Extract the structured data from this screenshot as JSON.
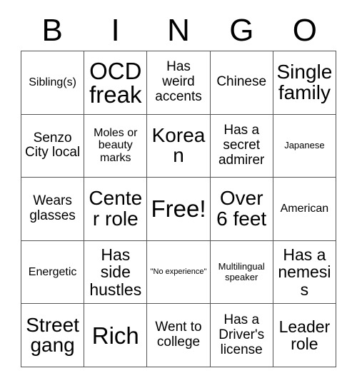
{
  "header": {
    "letters": [
      "B",
      "I",
      "N",
      "G",
      "O"
    ]
  },
  "colors": {
    "grid_line": "#555555",
    "text": "#000000",
    "background": "#ffffff"
  },
  "grid": {
    "columns": 5,
    "rows": 5,
    "cells": [
      {
        "text": "Sibling(s)",
        "size": "fs-md"
      },
      {
        "text": "OCD freak",
        "size": "fs-huge"
      },
      {
        "text": "Has weird accents",
        "size": "fs-lg"
      },
      {
        "text": "Chinese",
        "size": "fs-lg"
      },
      {
        "text": "Single family",
        "size": "fs-xxl"
      },
      {
        "text": "Senzo City local",
        "size": "fs-lg"
      },
      {
        "text": "Moles or beauty marks",
        "size": "fs-md"
      },
      {
        "text": "Korean",
        "size": "fs-xxl"
      },
      {
        "text": "Has a secret admirer",
        "size": "fs-lg"
      },
      {
        "text": "Japanese",
        "size": "fs-sm"
      },
      {
        "text": "Wears glasses",
        "size": "fs-lg"
      },
      {
        "text": "Center role",
        "size": "fs-xxl"
      },
      {
        "text": "Free!",
        "size": "fs-huge"
      },
      {
        "text": "Over 6 feet",
        "size": "fs-xxl"
      },
      {
        "text": "American",
        "size": "fs-md"
      },
      {
        "text": "Energetic",
        "size": "fs-md"
      },
      {
        "text": "Has side hustles",
        "size": "fs-xl"
      },
      {
        "text": "\"No experience\"",
        "size": "fs-xs"
      },
      {
        "text": "Multilingual speaker",
        "size": "fs-sm"
      },
      {
        "text": "Has a nemesis",
        "size": "fs-xl"
      },
      {
        "text": "Street gang",
        "size": "fs-xxl"
      },
      {
        "text": "Rich",
        "size": "fs-huge"
      },
      {
        "text": "Went to college",
        "size": "fs-lg"
      },
      {
        "text": "Has a Driver's license",
        "size": "fs-lg"
      },
      {
        "text": "Leader role",
        "size": "fs-xl"
      }
    ]
  }
}
